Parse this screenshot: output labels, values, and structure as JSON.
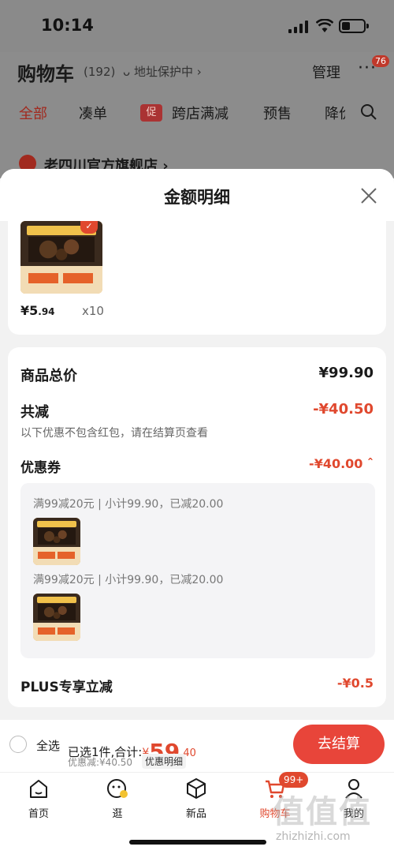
{
  "status_bar": {
    "time": "10:14"
  },
  "background": {
    "title": "购物车",
    "count": "(192)",
    "address": "ᴗ 地址保护中 ›",
    "manage": "管理",
    "more": "···",
    "more_badge": "76",
    "tabs": [
      "全部",
      "凑单",
      "跨店满减",
      "预售",
      "降价"
    ],
    "promo_tag": "促",
    "store_name": "老四川官方旗舰店 ›"
  },
  "sheet": {
    "title": "金额明细",
    "product": {
      "price_int": "¥5",
      "price_dec": ".94",
      "qty": "x10"
    },
    "total_label": "商品总价",
    "total_value": "¥99.90",
    "reduce_label": "共减",
    "reduce_value": "-¥40.50",
    "note": "以下优惠不包含红包，请在结算页查看",
    "coupon_label": "优惠券",
    "coupon_value": "-¥40.00 ˆ",
    "coupon_lines": [
      "满99减20元 | 小计99.90，已减20.00",
      "满99减20元 | 小计99.90，已减20.00"
    ],
    "plus_label": "PLUS专享立减",
    "plus_value": "-¥0.5"
  },
  "checkout": {
    "select_all": "全选",
    "summary_prefix": "已选1件,合计:",
    "currency": "¥",
    "amount_int": "59",
    "amount_dec": ".40",
    "discount": "优惠减:¥40.50",
    "detail_link": "优惠明细",
    "button": "去结算"
  },
  "tabbar": {
    "items": [
      "首页",
      "逛",
      "新品",
      "购物车",
      "我的"
    ],
    "badge": "99+"
  },
  "watermark": {
    "text": "值值值",
    "url": "zhizhizhi.com"
  },
  "colors": {
    "accent": "#e0482e",
    "button": "#e8453a",
    "store_check": "#a12a1f"
  }
}
